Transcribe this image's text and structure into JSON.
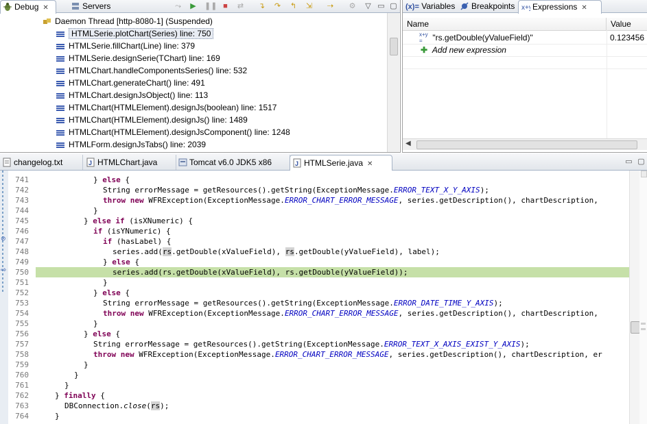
{
  "debug_view": {
    "tabs": [
      {
        "label": "Debug",
        "icon": "debug-bug-icon",
        "active": true
      },
      {
        "label": "Servers",
        "icon": "servers-icon",
        "active": false
      }
    ],
    "thread": "Daemon Thread [http-8080-1] (Suspended)",
    "frames": [
      "HTMLSerie.plotChart(Series) line: 750",
      "HTMLSerie.fillChart(Line) line: 379",
      "HTMLSerie.designSerie(TChart) line: 169",
      "HTMLChart.handleComponentsSeries() line: 532",
      "HTMLChart.generateChart() line: 491",
      "HTMLChart.designJsObject() line: 113",
      "HTMLChart(HTMLElement).designJs(boolean) line: 1517",
      "HTMLChart(HTMLElement).designJs() line: 1489",
      "HTMLChart(HTMLElement).designJsComponent() line: 1248",
      "HTMLForm.designJsTabs() line: 2039"
    ],
    "selected_frame_index": 0
  },
  "expressions_view": {
    "tabs": [
      {
        "label": "Variables",
        "prefix": "(x)=",
        "active": false
      },
      {
        "label": "Breakpoints",
        "active": false
      },
      {
        "label": "Expressions",
        "active": true
      }
    ],
    "columns": [
      "Name",
      "Value"
    ],
    "rows": [
      {
        "name": "\"rs.getDouble(yValueField)\"",
        "value": "0.123456",
        "icon": "watch-expression-icon"
      }
    ],
    "add_label": "Add new expression"
  },
  "editor": {
    "tabs": [
      {
        "label": "changelog.txt",
        "icon": "text-file-icon",
        "active": false
      },
      {
        "label": "HTMLChart.java",
        "icon": "java-file-icon",
        "active": false
      },
      {
        "label": "Tomcat v6.0 JDK5 x86",
        "icon": "server-config-icon",
        "active": false
      },
      {
        "label": "HTMLSerie.java",
        "icon": "java-file-icon",
        "active": true
      }
    ],
    "current_line": 750,
    "line_numbers": [
      "741",
      "742",
      "743",
      "744",
      "745",
      "746",
      "747",
      "748",
      "749",
      "750",
      "751",
      "752",
      "753",
      "754",
      "755",
      "756",
      "757",
      "758",
      "759",
      "760",
      "761",
      "762",
      "763",
      "764"
    ],
    "code": {
      "l741": {
        "a": "} ",
        "k1": "else",
        "b": " {"
      },
      "l742": {
        "a": "String errorMessage = getResources().getString(ExceptionMessage.",
        "c1": "ERROR_TEXT_X_Y_AXIS",
        "b": ");"
      },
      "l743": {
        "k1": "throw",
        "sp": " ",
        "k2": "new",
        "a": " WFRException(ExceptionMessage.",
        "c1": "ERROR_CHART_ERROR_MESSAGE",
        "b": ", series.getDescription(), chartDescription,"
      },
      "l744": {
        "a": "}"
      },
      "l745": {
        "a": "} ",
        "k1": "else",
        "sp": " ",
        "k2": "if",
        "b": " (isXNumeric) {"
      },
      "l746": {
        "k1": "if",
        "a": " (isYNumeric) {"
      },
      "l747": {
        "k1": "if",
        "a": " (hasLabel) {"
      },
      "l748": {
        "a": "series.add(",
        "o1": "rs",
        "b": ".getDouble(xValueField), ",
        "o2": "rs",
        "c": ".getDouble(yValueField), label);"
      },
      "l749": {
        "a": "} ",
        "k1": "else",
        "b": " {"
      },
      "l750": {
        "a": "series.add(rs.getDouble(xValueField), rs.getDouble(yValueField));"
      },
      "l751": {
        "a": "}"
      },
      "l752": {
        "a": "} ",
        "k1": "else",
        "b": " {"
      },
      "l753": {
        "a": "String errorMessage = getResources().getString(ExceptionMessage.",
        "c1": "ERROR_DATE_TIME_Y_AXIS",
        "b": ");"
      },
      "l754": {
        "k1": "throw",
        "sp": " ",
        "k2": "new",
        "a": " WFRException(ExceptionMessage.",
        "c1": "ERROR_CHART_ERROR_MESSAGE",
        "b": ", series.getDescription(), chartDescription,"
      },
      "l755": {
        "a": "}"
      },
      "l756": {
        "a": "} ",
        "k1": "else",
        "b": " {"
      },
      "l757": {
        "a": "String errorMessage = getResources().getString(ExceptionMessage.",
        "c1": "ERROR_TEXT_X_AXIS_EXIST_Y_AXIS",
        "b": ");"
      },
      "l758": {
        "k1": "throw",
        "sp": " ",
        "k2": "new",
        "a": " WFRException(ExceptionMessage.",
        "c1": "ERROR_CHART_ERROR_MESSAGE",
        "b": ", series.getDescription(), chartDescription, er"
      },
      "l759": {
        "a": "}"
      },
      "l760": {
        "a": "}"
      },
      "l761": {
        "a": "}"
      },
      "l762": {
        "a": "} ",
        "k1": "finally",
        "b": " {"
      },
      "l763": {
        "a": "DBConnection.",
        "i1": "close",
        "b": "(",
        "o1": "rs",
        "c": ");"
      },
      "l764": {
        "a": "}"
      }
    }
  },
  "colors": {
    "keyword": "#7f0055",
    "constant": "#0000c0",
    "current_line": "#c6e0a8",
    "occurrence": "#d4d4d4"
  }
}
